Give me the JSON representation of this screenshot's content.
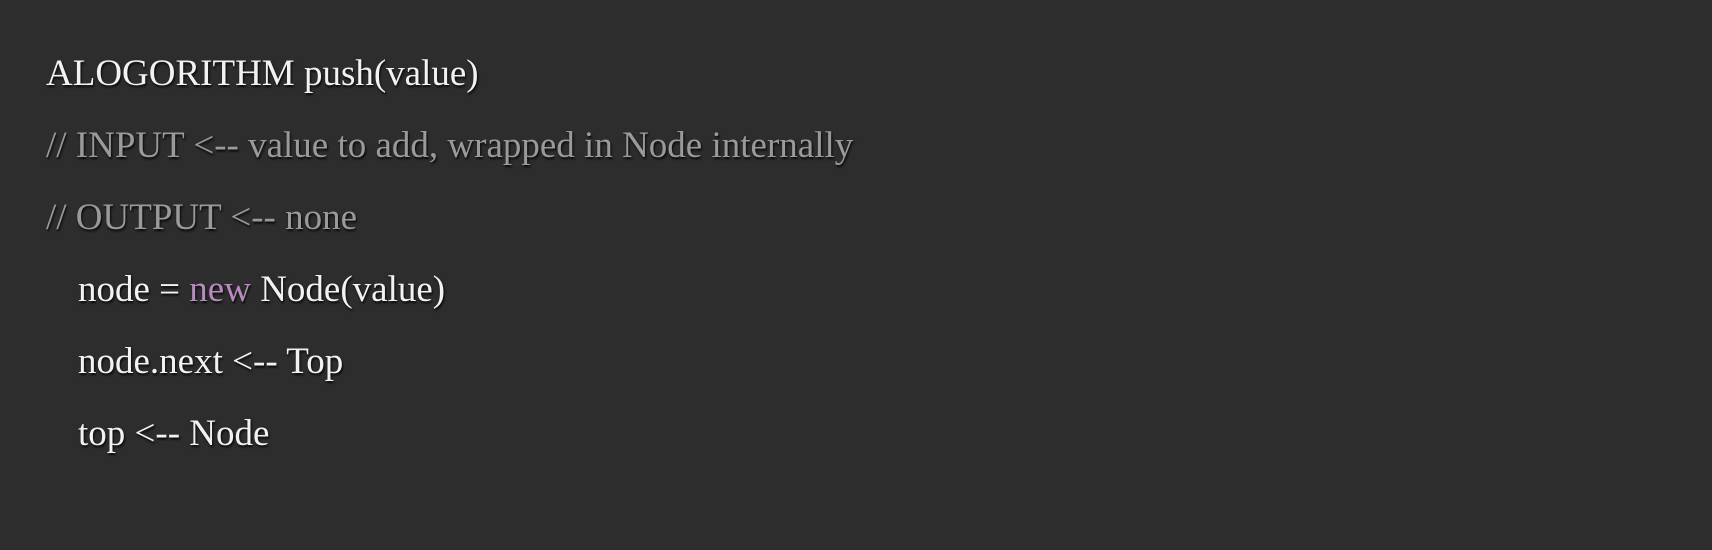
{
  "code": {
    "header": "ALOGORITHM push(value)",
    "comment_input": "// INPUT <-- value to add, wrapped in Node internally",
    "comment_output": "// OUTPUT <-- none",
    "line_node_lhs": "node = ",
    "line_node_keyword": "new",
    "line_node_rhs": " Node(value)",
    "line_next": "node.next <-- Top",
    "line_top": "top <-- Node"
  },
  "colors": {
    "background": "#2d2d2d",
    "text": "#f2f2f2",
    "comment": "#9a9a9a",
    "keyword": "#b88bc0"
  }
}
